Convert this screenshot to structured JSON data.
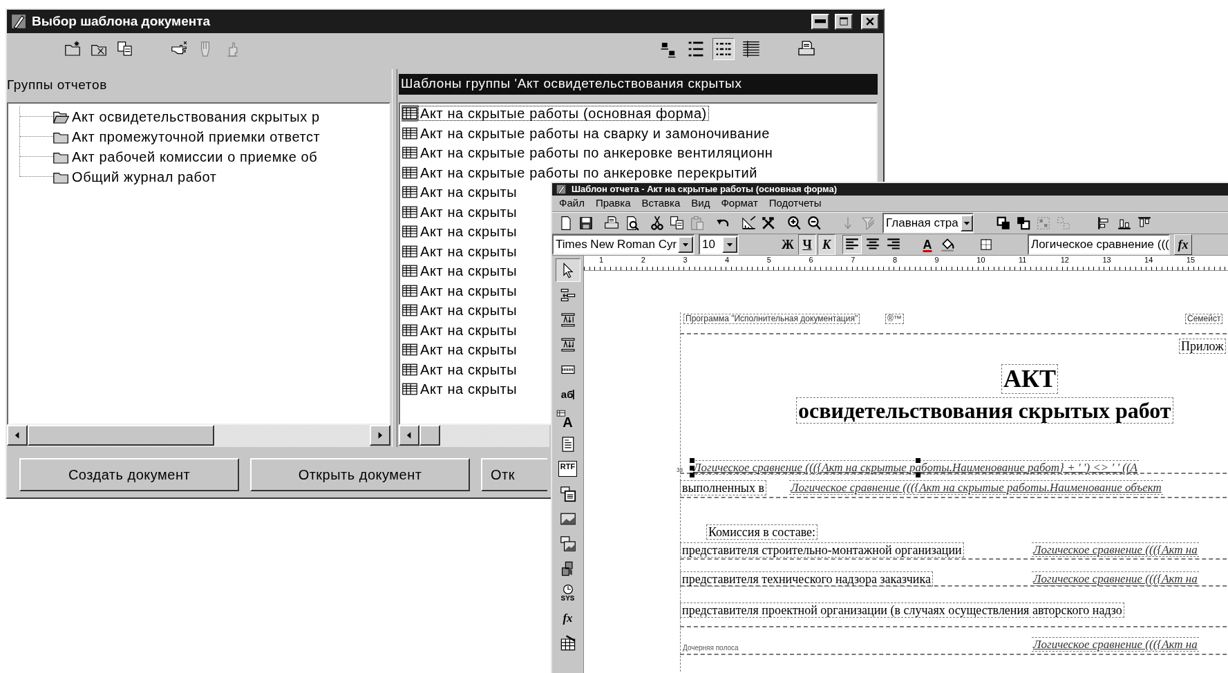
{
  "dialog": {
    "title": "Выбор шаблона документа",
    "toolbar_left": [
      {
        "kind": "new-folder",
        "disabled": false
      },
      {
        "kind": "folder-edit",
        "disabled": false
      },
      {
        "kind": "copy",
        "disabled": false
      },
      {
        "kind": "hand-point",
        "disabled": false
      },
      {
        "kind": "hand-down",
        "disabled": true
      },
      {
        "kind": "hand-up",
        "disabled": true
      }
    ],
    "toolbar_right": [
      {
        "kind": "large-icons",
        "selected": false
      },
      {
        "kind": "small-icons",
        "selected": false
      },
      {
        "kind": "list",
        "selected": true
      },
      {
        "kind": "details",
        "selected": false
      },
      {
        "kind": "print",
        "selected": false
      }
    ],
    "groups_pane": {
      "header": "Группы отчетов",
      "tree": [
        {
          "label": "Акт освидетельствования скрытых р",
          "open": true
        },
        {
          "label": "Акт промежуточной приемки ответст",
          "open": false
        },
        {
          "label": "Акт рабочей комиссии о приемке об",
          "open": false
        },
        {
          "label": "Общий журнал работ",
          "open": false
        }
      ]
    },
    "templates_pane": {
      "header": "Шаблоны группы 'Акт освидетельствования скрытых",
      "items": [
        {
          "label": "Акт на скрытые работы (основная форма)",
          "selected": true
        },
        {
          "label": "Акт на скрытые работы на сварку и замоночивание",
          "selected": false
        },
        {
          "label": "Акт на скрытые работы по анкеровке вентиляционн",
          "selected": false
        },
        {
          "label": "Акт на скрытые работы по анкеровке перекрытий",
          "selected": false
        },
        {
          "label": "Акт на скрыты",
          "selected": false
        },
        {
          "label": "Акт на скрыты",
          "selected": false
        },
        {
          "label": "Акт на скрыты",
          "selected": false
        },
        {
          "label": "Акт на скрыты",
          "selected": false
        },
        {
          "label": "Акт на скрыты",
          "selected": false
        },
        {
          "label": "Акт на скрыты",
          "selected": false
        },
        {
          "label": "Акт на скрыты",
          "selected": false
        },
        {
          "label": "Акт на скрыты",
          "selected": false
        },
        {
          "label": "Акт на скрыты",
          "selected": false
        },
        {
          "label": "Акт на скрыты",
          "selected": false
        },
        {
          "label": "Акт на скрыты",
          "selected": false
        }
      ]
    },
    "buttons": [
      "Создать документ",
      "Открыть документ",
      "Отк"
    ]
  },
  "designer": {
    "title": "Шаблон отчета - Акт на скрытые работы (основная форма)",
    "menu": [
      "Файл",
      "Правка",
      "Вставка",
      "Вид",
      "Формат",
      "Подотчеты"
    ],
    "toolbar_a": [
      {
        "kind": "new",
        "disabled": false
      },
      {
        "kind": "save",
        "disabled": false
      },
      {
        "kind": "print",
        "disabled": false
      },
      {
        "kind": "preview",
        "disabled": false
      },
      {
        "kind": "cut",
        "disabled": false
      },
      {
        "kind": "copy",
        "disabled": false
      },
      {
        "kind": "paste",
        "disabled": true
      },
      {
        "kind": "undo",
        "disabled": false
      },
      {
        "kind": "ruler",
        "disabled": false
      },
      {
        "kind": "tools",
        "disabled": false
      },
      {
        "kind": "zoom-in",
        "disabled": false
      },
      {
        "kind": "zoom-out",
        "disabled": false
      },
      {
        "kind": "sort",
        "disabled": true
      },
      {
        "kind": "filter",
        "disabled": true
      }
    ],
    "page_combo": "Главная стра",
    "toolbar_b": [
      {
        "kind": "front",
        "disabled": false
      },
      {
        "kind": "back",
        "disabled": false
      },
      {
        "kind": "group",
        "disabled": true
      },
      {
        "kind": "ungroup",
        "disabled": true
      },
      {
        "kind": "align-left-edge",
        "disabled": false
      },
      {
        "kind": "align-bottom",
        "disabled": false
      },
      {
        "kind": "align-top",
        "disabled": false
      }
    ],
    "font": "Times New Roman Cyr",
    "size": "10",
    "format_buttons": [
      {
        "label": "Ж",
        "selected": false
      },
      {
        "label": "Ч",
        "selected": true
      },
      {
        "label": "К",
        "selected": true
      }
    ],
    "align_buttons": [
      {
        "kind": "left",
        "selected": true
      },
      {
        "kind": "center",
        "selected": false
      },
      {
        "kind": "right",
        "selected": false
      }
    ],
    "font_color_label": "A",
    "formula": "Логическое сравнение (((",
    "fx_label": "fx",
    "ruler": [
      "1",
      "2",
      "3",
      "4",
      "5",
      "6",
      "7",
      "8",
      "9",
      "10",
      "11",
      "12",
      "13",
      "14",
      "15"
    ],
    "tools": [
      {
        "kind": "pointer",
        "selected": true
      },
      {
        "kind": "band",
        "selected": false
      },
      {
        "kind": "group-header",
        "selected": false
      },
      {
        "kind": "group-footer",
        "selected": false
      },
      {
        "kind": "hatched-band",
        "selected": false
      },
      {
        "kind": "text",
        "label": "аб",
        "selected": false
      },
      {
        "kind": "data-text",
        "label": "A",
        "selected": false
      },
      {
        "kind": "memo",
        "selected": false
      },
      {
        "kind": "rtf",
        "label": "RTF",
        "selected": false
      },
      {
        "kind": "data-rtf",
        "selected": false
      },
      {
        "kind": "picture",
        "selected": false
      },
      {
        "kind": "data-picture",
        "selected": false
      },
      {
        "kind": "shape",
        "selected": false
      },
      {
        "kind": "system",
        "label": "SYS",
        "selected": false
      },
      {
        "kind": "function",
        "label": "fx",
        "selected": false
      },
      {
        "kind": "table",
        "selected": false
      }
    ],
    "elements": [
      {
        "kind": "small",
        "text": "Программа \"Исполнительная документация\""
      },
      {
        "kind": "small",
        "text": "®™"
      },
      {
        "kind": "small",
        "text": "Семейст"
      },
      {
        "kind": "label",
        "text": "Прилож"
      },
      {
        "kind": "title",
        "text": "АКТ"
      },
      {
        "kind": "subtitle",
        "text": "освидетельствования скрытых работ"
      },
      {
        "kind": "tiny",
        "text": "зз"
      },
      {
        "kind": "formula",
        "text": "Логическое сравнение ((({Акт на скрытые работы.Наименование работ} + ' ') <> ' ' ((А",
        "selected": true
      },
      {
        "kind": "label",
        "text": "выполненных в"
      },
      {
        "kind": "formula",
        "text": "Логическое сравнение ((({Акт на скрытые работы.Наименование объект",
        "selected": false
      },
      {
        "kind": "label",
        "text": "Комиссия в составе:"
      },
      {
        "kind": "label",
        "text": "представителя строительно-монтажной организации"
      },
      {
        "kind": "formula",
        "text": "Логическое сравнение ((({Акт на",
        "selected": false
      },
      {
        "kind": "label",
        "text": "представителя технического надзора заказчика"
      },
      {
        "kind": "formula",
        "text": "Логическое сравнение ((({Акт на",
        "selected": false
      },
      {
        "kind": "label",
        "text": "представителя проектной организации (в случаях осуществления авторского надзо"
      },
      {
        "kind": "tiny",
        "text": "Дочерняя полоса"
      },
      {
        "kind": "formula",
        "text": "Логическое сравнение ((({Акт на",
        "selected": false
      }
    ]
  }
}
